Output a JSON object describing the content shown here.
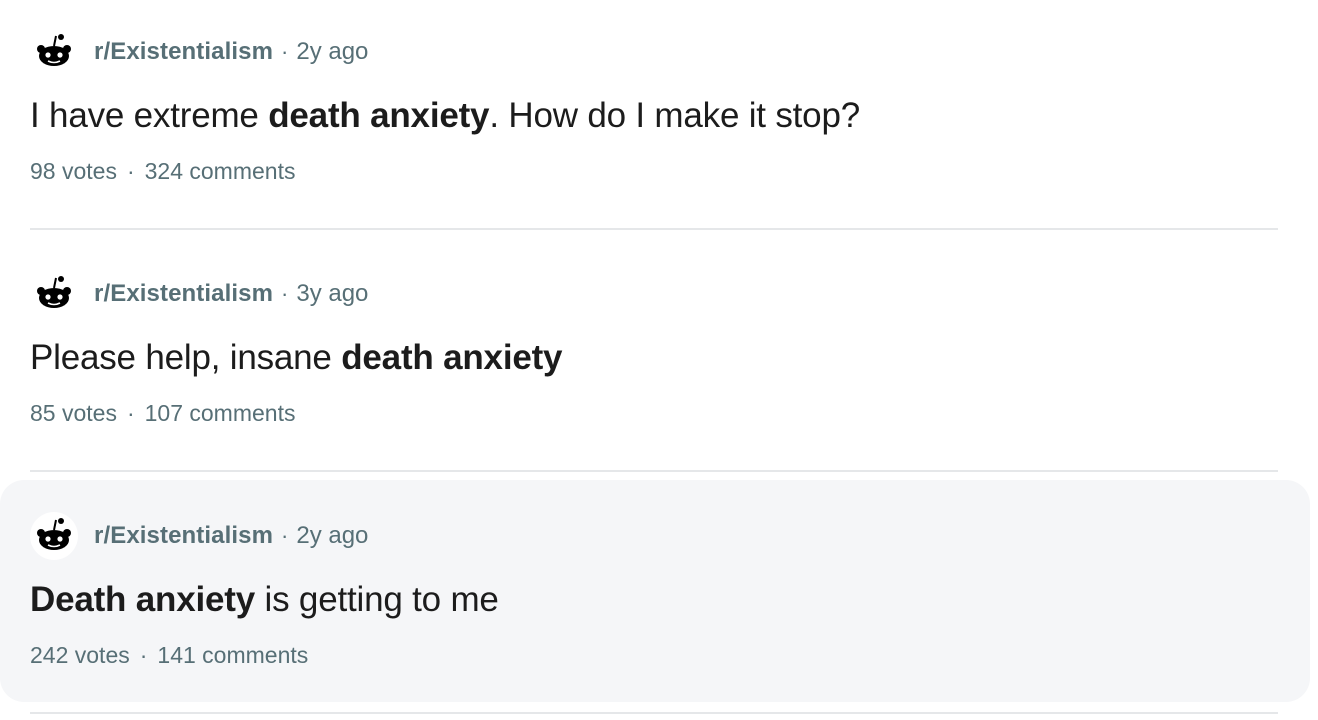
{
  "posts": [
    {
      "subreddit": "r/Existentialism",
      "separator": "·",
      "age": "2y ago",
      "title_parts": [
        {
          "text": "I have extreme ",
          "bold": false
        },
        {
          "text": "death anxiety",
          "bold": true
        },
        {
          "text": ". How do I make it stop?",
          "bold": false
        }
      ],
      "votes": "98 votes",
      "stats_separator": "·",
      "comments": "324 comments",
      "highlighted": false
    },
    {
      "subreddit": "r/Existentialism",
      "separator": "·",
      "age": "3y ago",
      "title_parts": [
        {
          "text": "Please help, insane ",
          "bold": false
        },
        {
          "text": "death anxiety",
          "bold": true
        }
      ],
      "votes": "85 votes",
      "stats_separator": "·",
      "comments": "107 comments",
      "highlighted": false
    },
    {
      "subreddit": "r/Existentialism",
      "separator": "·",
      "age": "2y ago",
      "title_parts": [
        {
          "text": "Death anxiety",
          "bold": true
        },
        {
          "text": " is getting to me",
          "bold": false
        }
      ],
      "votes": "242 votes",
      "stats_separator": "·",
      "comments": "141 comments",
      "highlighted": true
    }
  ],
  "icons": {
    "avatar": "reddit-snoo-icon"
  },
  "colors": {
    "meta_text": "#576f76",
    "title_text": "#1c1c1c",
    "highlight_bg": "#f5f6f8",
    "divider": "#e5e7e9"
  }
}
